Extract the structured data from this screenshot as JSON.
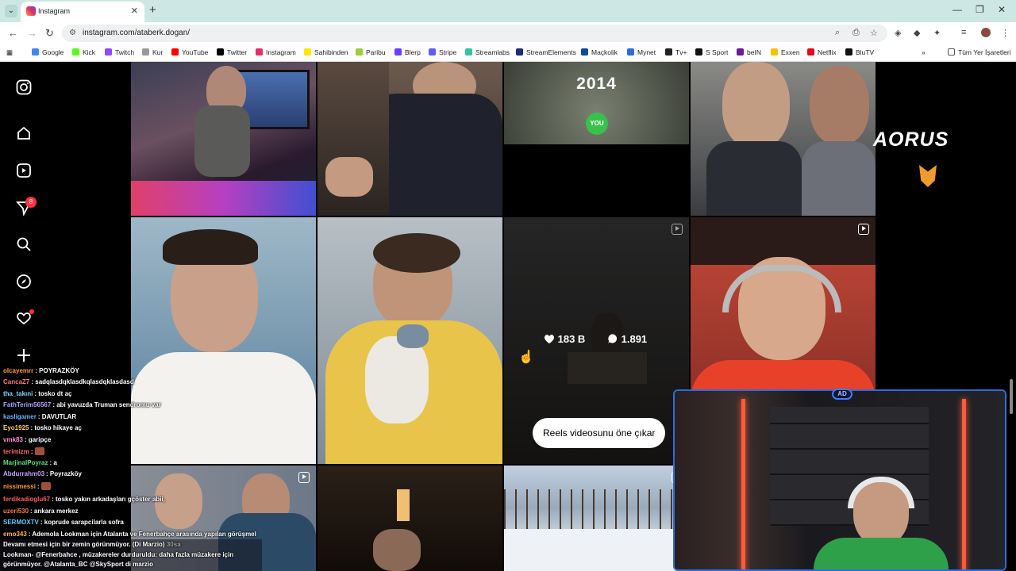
{
  "browser": {
    "tab_title": "Instagram",
    "url": "instagram.com/ataberk.dogan/",
    "bookmarks": [
      "Google",
      "Kick",
      "Twitch",
      "Kur",
      "YouTube",
      "Twitter",
      "Instagram",
      "Sahibinden",
      "Paribu",
      "Blerp",
      "Stripe",
      "Streamlabs",
      "StreamElements",
      "Maçkolik",
      "Mynet",
      "Tv+",
      "S Sport",
      "beIN",
      "Exxen",
      "Netflix",
      "BluTV"
    ],
    "bookmark_folder": "Tüm Yer İşaretleri"
  },
  "sidebar": {
    "notification_count": "8"
  },
  "post_overlay": {
    "likes": "183 B",
    "comments": "1.891",
    "pin_button": "Reels videosunu öne çıkar"
  },
  "posts": {
    "year_text": "2014",
    "badge_text": "YOU"
  },
  "brand": {
    "name": "AORUS"
  },
  "chat": [
    {
      "user": "olcayemrr",
      "msg": "POYRAZKÖY",
      "color": "#ff9d2e"
    },
    {
      "user": "CancaZ7",
      "msg": "sadqlasdqklasdkqlasdqklasdasd",
      "color": "#ff7b7b"
    },
    {
      "user": "tha_takıni",
      "msg": "tosko dt aç",
      "color": "#8ad4ff"
    },
    {
      "user": "FathTerim56567",
      "msg": "abi yavuzda Truman sendromu var",
      "color": "#b4a0ff"
    },
    {
      "user": "kasligamer",
      "msg": "DAVUTLAR",
      "color": "#66b3ff"
    },
    {
      "user": "Eyo1925",
      "msg": "tosko hikaye aç",
      "color": "#ffd54d"
    },
    {
      "user": "vmk83",
      "msg": "garipçe",
      "color": "#ff8ad8"
    },
    {
      "user": "terimizm",
      "msg": "",
      "color": "#ff6b6b"
    },
    {
      "user": "MarjinalPoyraz",
      "msg": "a",
      "color": "#5ce27a"
    },
    {
      "user": "Abdurrahm03",
      "msg": "Poyrazköy",
      "color": "#c5a3ff"
    },
    {
      "user": "nissimessi",
      "msg": "",
      "color": "#ff9d2e"
    },
    {
      "user": "ferdikadioglu67",
      "msg": "tosko yakın arkadaşları gçöster abii,",
      "color": "#ff5c5c"
    },
    {
      "user": "uzeri530",
      "msg": "ankara merkez",
      "color": "#ff7b3a"
    },
    {
      "user": "SERMOXTV",
      "msg": "koprude sarapcilarla sofra",
      "color": "#5cd0ff"
    },
    {
      "user": "emo343",
      "msg": "Ademola Lookman için Atalanta ve Fenerbahçe arasında yapılan görüşmel",
      "color": "#ffb34d"
    }
  ],
  "ticker": {
    "line1": "Devamı etmesi için bir zemin görünmüyor. (Di Marzio)",
    "tag": "30sa",
    "line2": "Lookman- @Fenerbahce , müzakereler durduruldu: daha fazla müzakere için",
    "line3": "görünmüyor. @Atalanta_BC @SkySport di marzio"
  }
}
